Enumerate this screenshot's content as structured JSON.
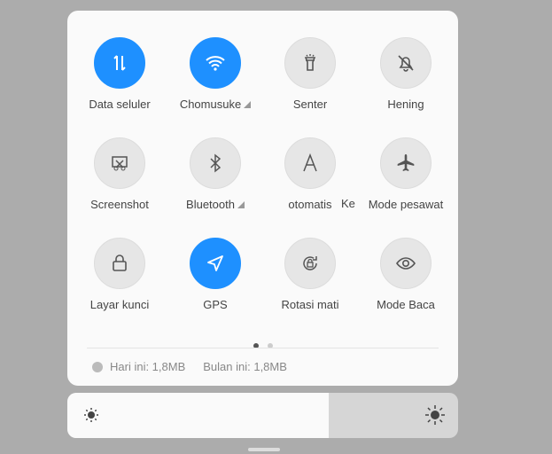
{
  "tiles": [
    {
      "label": "Data seluler",
      "icon": "data-arrows-icon",
      "active": true,
      "more": false
    },
    {
      "label": "Chomusuke",
      "icon": "wifi-icon",
      "active": true,
      "more": true
    },
    {
      "label": "Senter",
      "icon": "flashlight-icon",
      "active": false,
      "more": false
    },
    {
      "label": "Hening",
      "icon": "bell-off-icon",
      "active": false,
      "more": false
    },
    {
      "label": "Screenshot",
      "icon": "screenshot-icon",
      "active": false,
      "more": false
    },
    {
      "label": "Bluetooth",
      "icon": "bluetooth-icon",
      "active": false,
      "more": true
    },
    {
      "label": "otomatis",
      "icon": "auto-brightness-icon",
      "active": false,
      "more": false
    },
    {
      "label": "Mode pesawat",
      "icon": "airplane-icon",
      "active": false,
      "more": false
    },
    {
      "label": "Layar kunci",
      "icon": "lock-icon",
      "active": false,
      "more": false
    },
    {
      "label": "GPS",
      "icon": "location-icon",
      "active": true,
      "more": false
    },
    {
      "label": "Rotasi mati",
      "icon": "rotation-lock-icon",
      "active": false,
      "more": false
    },
    {
      "label": "Mode Baca",
      "icon": "eye-icon",
      "active": false,
      "more": false
    }
  ],
  "marquee_fragment": "Ke",
  "pager": {
    "pages": 2,
    "current": 1
  },
  "usage": {
    "today": "Hari ini: 1,8MB",
    "month": "Bulan ini: 1,8MB"
  },
  "brightness": {
    "level_percent": 67
  },
  "colors": {
    "accent": "#1e90ff",
    "background": "#acacac"
  }
}
